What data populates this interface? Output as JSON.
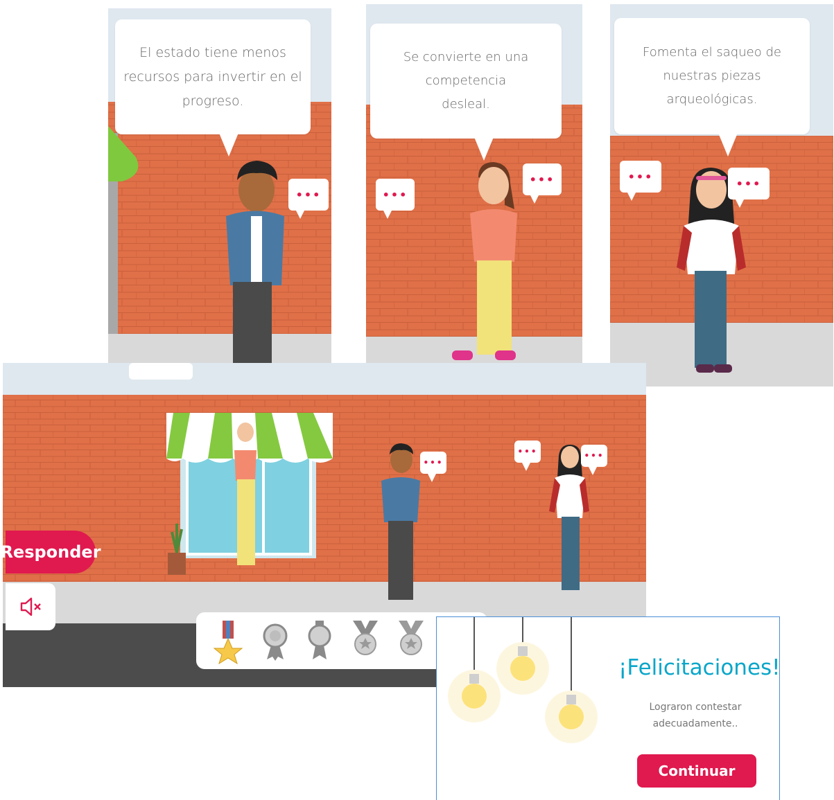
{
  "panels": [
    {
      "speech": "El estado tiene menos recursos para invertir en el progreso."
    },
    {
      "speech": "Se convierte en una competencia desleal."
    },
    {
      "speech": "Fomenta el saqueo de nuestras piezas arqueológicas."
    }
  ],
  "speech_dots": "•••",
  "scene": {
    "respond_label": "Responder",
    "mute_icon": "speaker-muted-icon",
    "medals": [
      "gold-star-medal-icon",
      "silver-rosette-medal-icon",
      "gray-medal-icon",
      "silver-star-medal-icon",
      "gray-star-medal-icon"
    ]
  },
  "congrats": {
    "title": "¡Felicitaciones!",
    "message": "Lograron contestar adecuadamente..",
    "button": "Continuar"
  },
  "colors": {
    "accent": "#e0194f",
    "title": "#0aa6c9",
    "brick": "#e07048",
    "sky": "#dfe8ef"
  }
}
